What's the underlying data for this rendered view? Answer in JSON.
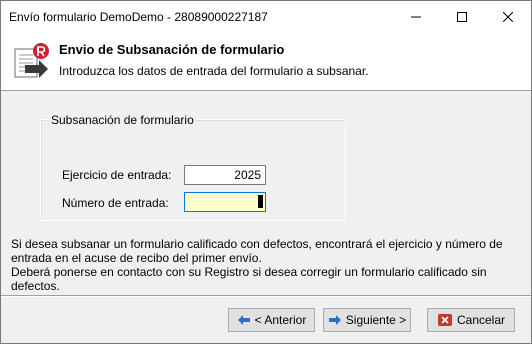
{
  "window": {
    "title": "Envío formulario DemoDemo - 28089000227187",
    "controls": {
      "minimize": "minimize-icon",
      "maximize": "maximize-icon",
      "close": "close-icon"
    }
  },
  "header": {
    "icon": "form-export-icon",
    "title": "Envio de Subsanación de formulario",
    "subtitle": "Introduzca los datos de entrada del formulario a subsanar."
  },
  "group": {
    "label": "Subsanación de formulario",
    "fields": [
      {
        "label": "Ejercicio de entrada:",
        "value": "2025"
      },
      {
        "label": "Número de entrada:",
        "value": ""
      }
    ]
  },
  "info": {
    "line1": "Si desea subsanar un formulario calificado con defectos, encontrará el ejercicio y número de entrada en el acuse de recibo del primer envío.",
    "line2": "Deberá ponerse en contacto con su Registro si desea corregir un formulario calificado sin defectos."
  },
  "buttons": {
    "previous": "< Anterior",
    "next": "Siguiente >",
    "cancel": "Cancelar"
  },
  "colors": {
    "accent": "#0078d7",
    "input_highlight": "#ffffcc",
    "cancel_icon": "#c0392b",
    "nav_icon": "#2e6ec2"
  }
}
